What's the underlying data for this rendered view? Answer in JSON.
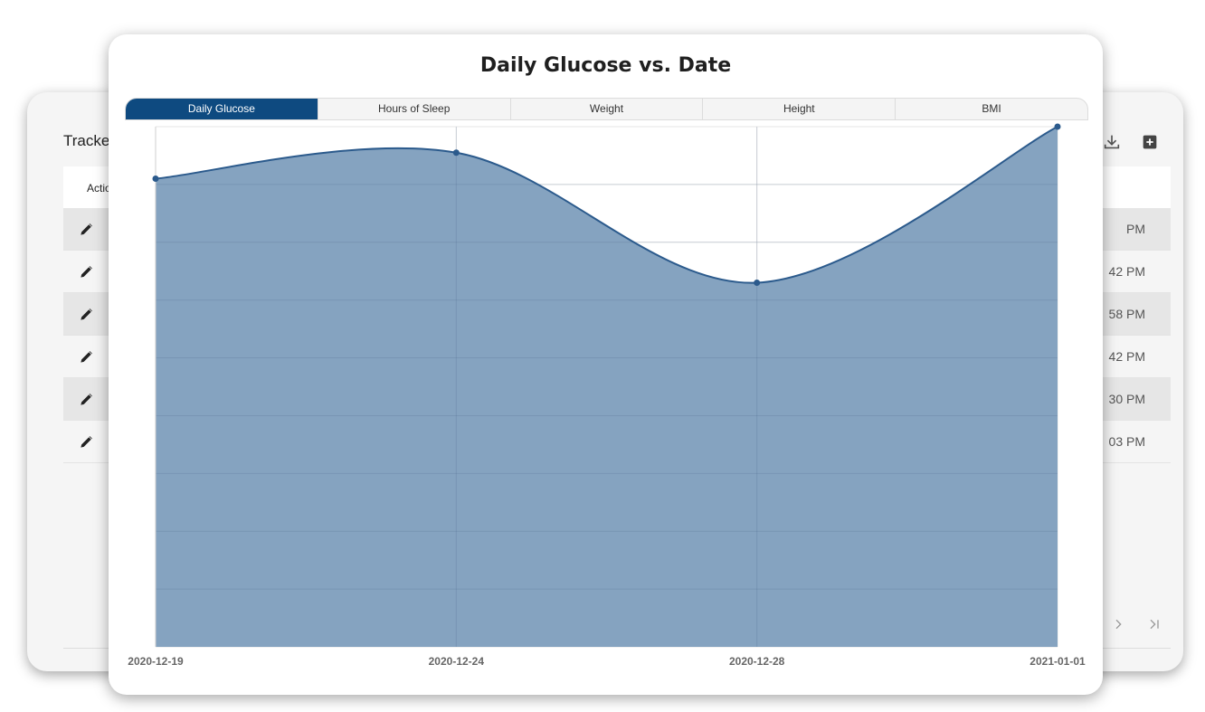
{
  "background": {
    "title": "Tracke",
    "header": {
      "actions_label": "Actions"
    },
    "rows": [
      {
        "time": "PM",
        "shaded": true
      },
      {
        "time": "42 PM",
        "shaded": false
      },
      {
        "time": "58 PM",
        "shaded": true
      },
      {
        "time": "42 PM",
        "shaded": false
      },
      {
        "time": "30 PM",
        "shaded": true
      },
      {
        "time": "03 PM",
        "shaded": false
      }
    ],
    "icons": {
      "download": "download-icon",
      "add": "add-box-icon",
      "edit": "edit-icon",
      "delete": "delete-icon",
      "next": "chevron-right-icon",
      "last": "last-page-icon"
    }
  },
  "chart_card": {
    "title": "Daily Glucose vs. Date",
    "tabs": [
      {
        "label": "Daily Glucose",
        "active": true
      },
      {
        "label": "Hours of Sleep",
        "active": false
      },
      {
        "label": "Weight",
        "active": false
      },
      {
        "label": "Height",
        "active": false
      },
      {
        "label": "BMI",
        "active": false
      }
    ]
  },
  "chart_data": {
    "type": "area",
    "title": "Daily Glucose vs. Date",
    "x": [
      "2020-12-19",
      "2020-12-24",
      "2020-12-28",
      "2021-01-01"
    ],
    "tick_labels": [
      "2020-12-19",
      "2020-12-24",
      "2020-12-28",
      "2021-01-01"
    ],
    "series": [
      {
        "values": [
          90,
          95,
          70,
          100
        ]
      }
    ],
    "ylim": [
      0,
      100
    ],
    "grid": true,
    "y_tick_labels_visible": false,
    "curve": "smooth",
    "colors": {
      "line": "#2b5a8c",
      "fill": "#85a3c0",
      "marker": "#2b5a8c"
    }
  },
  "colors": {
    "accent": "#0e4a80",
    "row_shade": "#e6e6e6"
  }
}
